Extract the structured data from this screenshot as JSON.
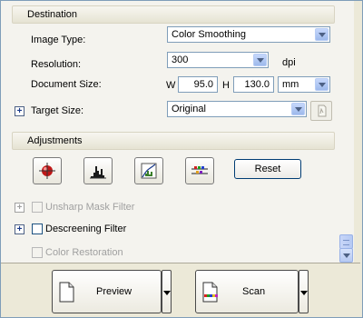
{
  "destination": {
    "header": "Destination",
    "image_type": {
      "label": "Image Type:",
      "value": "Color Smoothing"
    },
    "resolution": {
      "label": "Resolution:",
      "value": "300",
      "unit": "dpi"
    },
    "document_size": {
      "label": "Document Size:",
      "w_label": "W",
      "w_value": "95.0",
      "h_label": "H",
      "h_value": "130.0",
      "unit": "mm"
    },
    "target_size": {
      "label": "Target Size:",
      "value": "Original"
    }
  },
  "adjustments": {
    "header": "Adjustments",
    "reset_label": "Reset",
    "unsharp_mask": {
      "label": "Unsharp Mask Filter",
      "checked": false,
      "enabled": false
    },
    "descreening": {
      "label": "Descreening Filter",
      "checked": false,
      "enabled": true
    },
    "color_restoration": {
      "label": "Color Restoration",
      "checked": false,
      "enabled": false
    }
  },
  "actions": {
    "preview_label": "Preview",
    "scan_label": "Scan"
  }
}
